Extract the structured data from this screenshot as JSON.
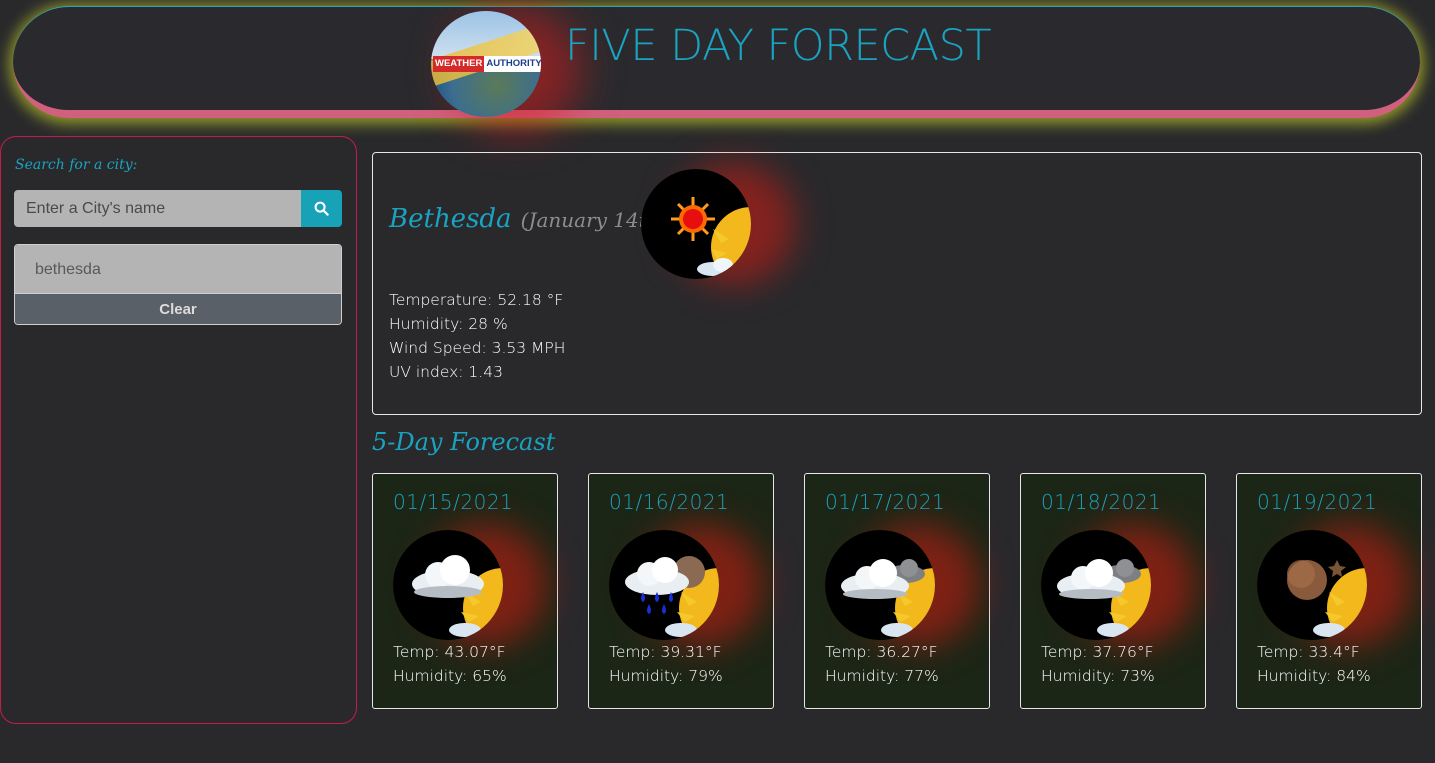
{
  "header": {
    "title": "FIVE DAY FORECAST",
    "logo_word1": "WEATHER",
    "logo_word2": "AUTHORITY"
  },
  "sidebar": {
    "search_label": "Search for a city:",
    "search_placeholder": "Enter a City's name",
    "search_value": "",
    "search_icon": "search-icon",
    "history": [
      "bethesda"
    ],
    "clear_label": "Clear"
  },
  "current": {
    "city": "Bethesda",
    "date": "(January 14th )",
    "icon": "sun-partly-icon",
    "temperature": "Temperature: 52.18 °F",
    "humidity": "Humidity: 28 %",
    "wind": "Wind Speed: 3.53 MPH",
    "uv": "UV index: 1.43"
  },
  "forecast": {
    "title": "5-Day Forecast",
    "days": [
      {
        "date": "01/15/2021",
        "icon": "cloudy-icon",
        "temp": "Temp: 43.07°F",
        "humidity": "Humidity: 65%"
      },
      {
        "date": "01/16/2021",
        "icon": "rain-icon",
        "temp": "Temp: 39.31°F",
        "humidity": "Humidity: 79%"
      },
      {
        "date": "01/17/2021",
        "icon": "cloudy-icon",
        "temp": "Temp: 36.27°F",
        "humidity": "Humidity: 77%"
      },
      {
        "date": "01/18/2021",
        "icon": "cloudy-icon",
        "temp": "Temp: 37.76°F",
        "humidity": "Humidity: 73%"
      },
      {
        "date": "01/19/2021",
        "icon": "moon-icon",
        "temp": "Temp: 33.4°F",
        "humidity": "Humidity: 84%"
      }
    ]
  },
  "colors": {
    "accent": "#1aa3c1",
    "header_border": "#d0607e",
    "sidebar_border": "#c01f4a",
    "card_bg": "#1c2616",
    "page_bg": "#29292c"
  }
}
